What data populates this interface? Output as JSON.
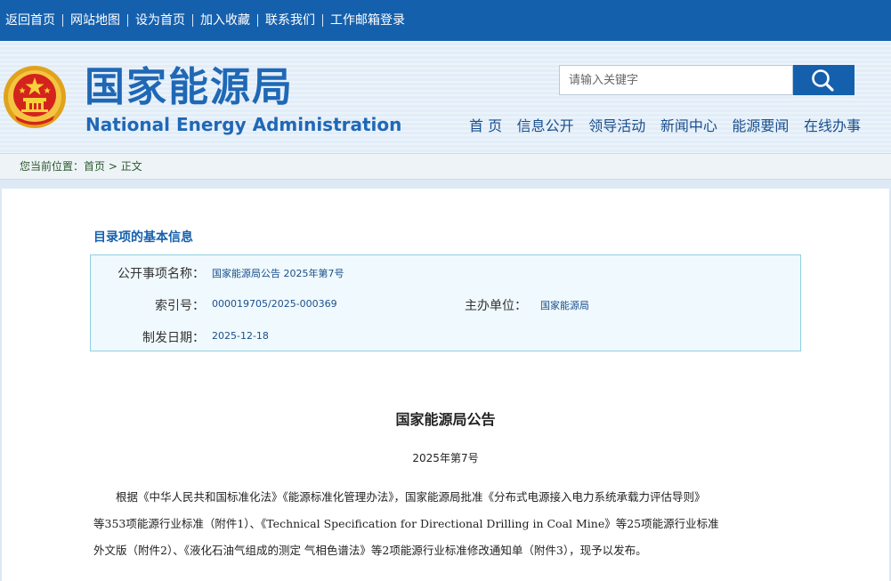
{
  "topbar": {
    "links": [
      "返回首页",
      "网站地图",
      "设为首页",
      "加入收藏",
      "联系我们",
      "工作邮箱登录"
    ]
  },
  "header": {
    "site_name_cn": "国家能源局",
    "site_name_en": "National Energy Administration",
    "search_placeholder": "请输入关键字",
    "nav": [
      "首 页",
      "信息公开",
      "领导活动",
      "新闻中心",
      "能源要闻",
      "在线办事"
    ]
  },
  "breadcrumb": {
    "prefix": "您当前位置：",
    "home": "首页",
    "sep": ">",
    "current": "正文"
  },
  "info": {
    "title": "目录项的基本信息",
    "name_label": "公开事项名称：",
    "name_value": "国家能源局公告 2025年第7号",
    "index_label": "索引号：",
    "index_value": "000019705/2025-000369",
    "org_label": "主办单位：",
    "org_value": "国家能源局",
    "date_label": "制发日期：",
    "date_value": "2025-12-18"
  },
  "doc": {
    "title": "国家能源局公告",
    "number": "2025年第7号",
    "lines": [
      "　　根据《中华人民共和国标准化法》《能源标准化管理办法》，国家能源局批准《分布式电源接入电力系统承载力评估导则》",
      "等353项能源行业标准（附件1）、《Technical Specification for Directional Drilling in Coal Mine》等25项能源行业标准",
      "外文版（附件2）、《液化石油气组成的测定 气相色谱法》等2项能源行业标准修改通知单（附件3），现予以发布。"
    ]
  },
  "colors": {
    "topbar_bg": "#1560ad",
    "brand_blue": "#1f68b6",
    "info_border": "#8fd0e0"
  }
}
